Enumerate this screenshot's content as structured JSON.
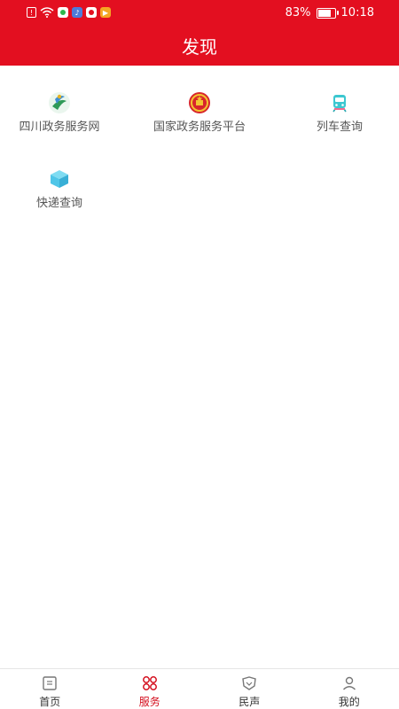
{
  "status_bar": {
    "battery": "83%",
    "time": "10:18"
  },
  "header": {
    "title": "发现"
  },
  "services": [
    {
      "label": "四川政务服务网",
      "icon": "sichuan-gov-logo-icon"
    },
    {
      "label": "国家政务服务平台",
      "icon": "national-emblem-icon"
    },
    {
      "label": "列车查询",
      "icon": "train-icon"
    },
    {
      "label": "快递查询",
      "icon": "package-icon"
    }
  ],
  "tabs": [
    {
      "label": "首页",
      "icon": "home-icon"
    },
    {
      "label": "服务",
      "icon": "service-grid-icon",
      "active": true
    },
    {
      "label": "民声",
      "icon": "voice-icon"
    },
    {
      "label": "我的",
      "icon": "user-icon"
    }
  ],
  "colors": {
    "brand_red": "#e30f20",
    "active_tab": "#d40f1e",
    "train": "#3cc7d0",
    "package": "#4fc6e8"
  }
}
